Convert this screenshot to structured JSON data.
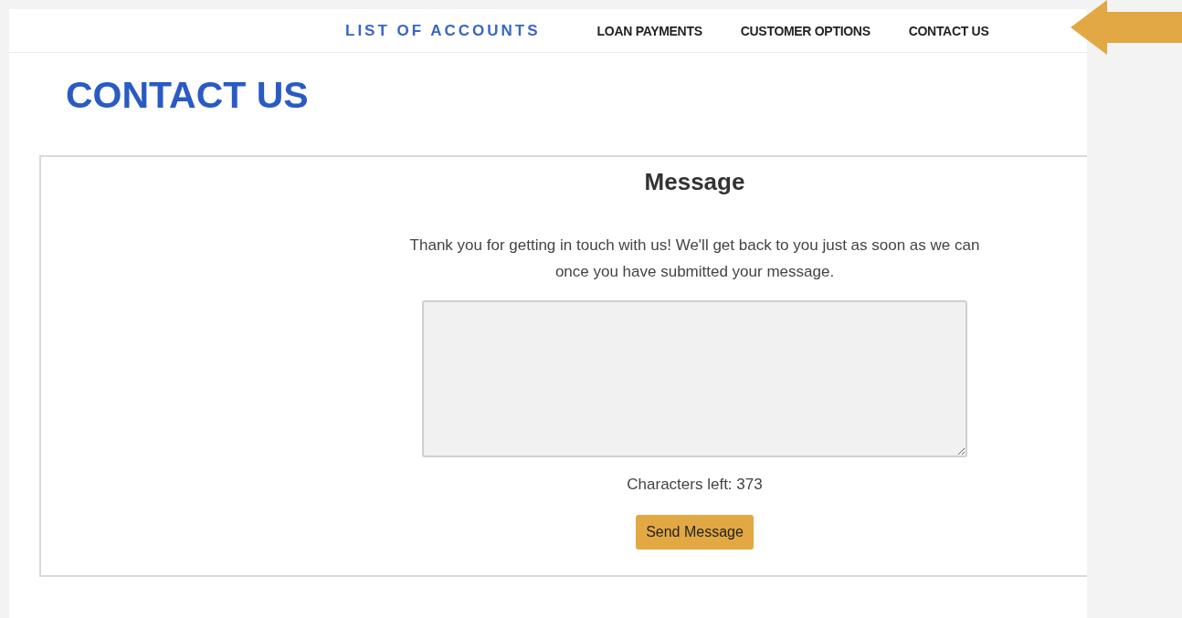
{
  "nav": {
    "title": "LIST OF ACCOUNTS",
    "links": [
      "LOAN PAYMENTS",
      "CUSTOMER OPTIONS",
      "CONTACT US"
    ],
    "pointer_arrow": true
  },
  "page_title": "CONTACT US",
  "form": {
    "heading": "Message",
    "intro": "Thank you for getting in touch with us! We'll get back to you just as soon as we can once you have submitted your message.",
    "counter": "Characters left: 373",
    "button": "Send Message"
  }
}
